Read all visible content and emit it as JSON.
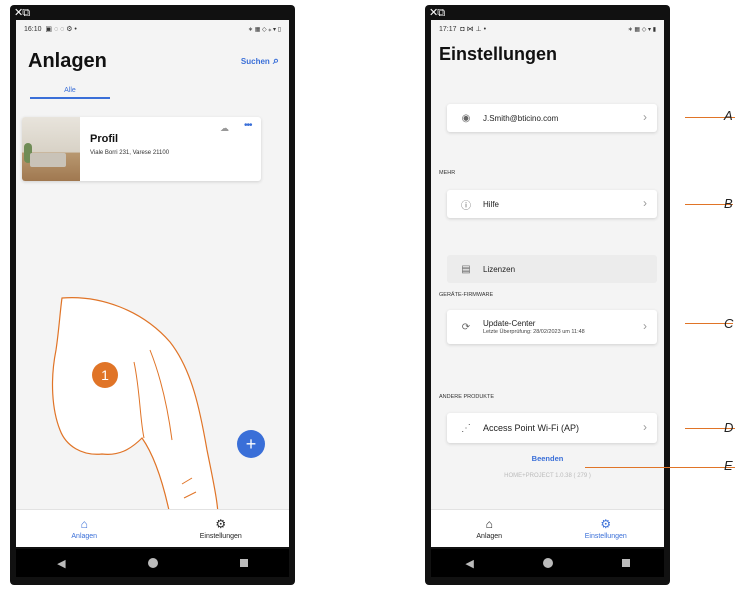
{
  "left_phone": {
    "status": {
      "time": "16:10",
      "left_icons": "▣ ◌ ◌ ⚙ •",
      "right_icons": "∗ ▦ ◇ ⁎ ▾ ▯"
    },
    "title": "Anlagen",
    "search_label": "Suchen",
    "tab_label": "Alle",
    "card": {
      "title": "Profil",
      "address": "Viale Borri 231, Varese 21100"
    },
    "step_number": "1",
    "bottom_tabs": [
      {
        "label": "Anlagen",
        "active": true
      },
      {
        "label": "Einstellungen",
        "active": false
      }
    ]
  },
  "right_phone": {
    "status": {
      "time": "17:17",
      "left_icons": "◘ ⋈ ⊥ •",
      "right_icons": "∗ ▦ ◇ ▾ ▮"
    },
    "title": "Einstellungen",
    "account": "J.Smith@bticino.com",
    "section_mehr": "MEHR",
    "hilfe": "Hilfe",
    "lizenzen": "Lizenzen",
    "section_firmware": "GERÄTE-FIRMWARE",
    "update_center": "Update-Center",
    "update_last": "Letzte Überprüfung: 28/02/2023 um 11:48",
    "section_andere": "ANDERE PRODUKTE",
    "access_point": "Access Point Wi-Fi (AP)",
    "logout": "Beenden",
    "version": "HOME+PROJECT 1.0.38 ( 279 )",
    "bottom_tabs": [
      {
        "label": "Anlagen",
        "active": false
      },
      {
        "label": "Einstellungen",
        "active": true
      }
    ]
  },
  "callouts": [
    "A",
    "B",
    "C",
    "D",
    "E"
  ],
  "colors": {
    "accent": "#3a6fd8",
    "callout": "#e07427"
  }
}
